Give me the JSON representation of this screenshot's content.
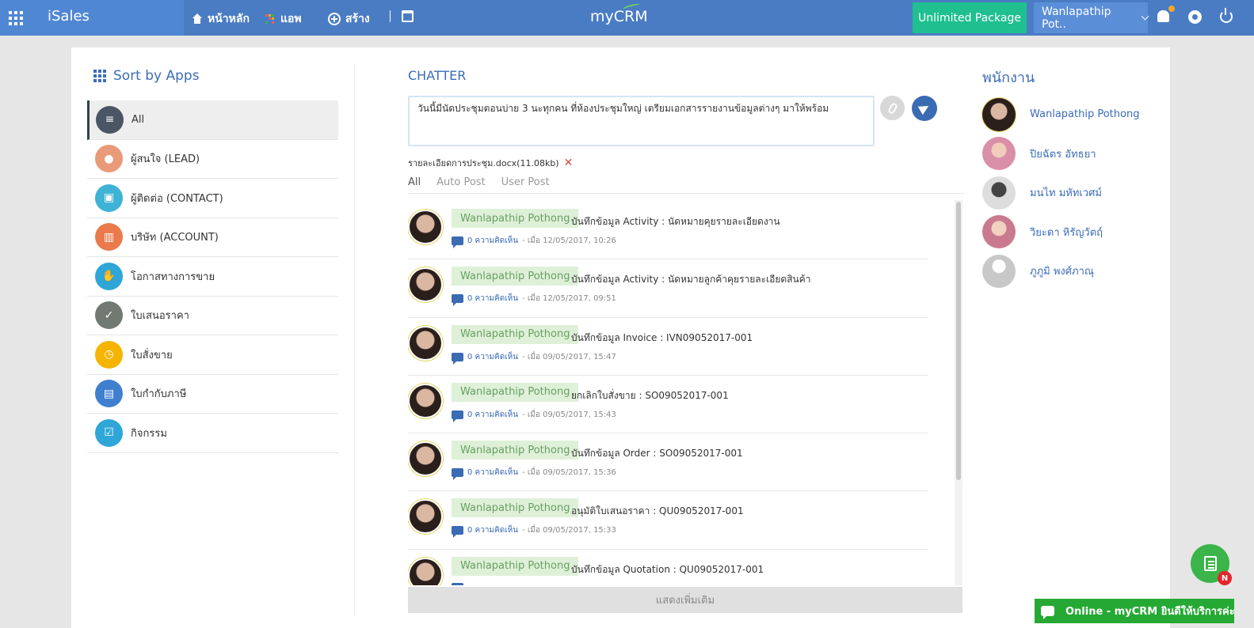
{
  "topbar": {
    "brand": "iSales",
    "nav": {
      "home": "หน้าหลัก",
      "apps": "แอพ",
      "create": "สร้าง"
    },
    "logo": "myCRM",
    "package": "Unlimited Package",
    "user": "Wanlapathip Pot..",
    "colors": {
      "bar": "#4a7cc4",
      "package": "#1fbf8f",
      "notify_dot": "#f5a623"
    }
  },
  "sort": {
    "title": "Sort by Apps",
    "items": [
      {
        "label": "All",
        "color": "#4a5565",
        "icon": "list-icon"
      },
      {
        "label": "ผู้สนใจ (LEAD)",
        "color": "#e99a78",
        "icon": "lead-icon"
      },
      {
        "label": "ผู้ติดต่อ (CONTACT)",
        "color": "#3fb3d6",
        "icon": "contact-card-icon"
      },
      {
        "label": "บริษัท (ACCOUNT)",
        "color": "#ea7a4c",
        "icon": "building-icon"
      },
      {
        "label": "โอกาสทางการขาย",
        "color": "#2ea6d8",
        "icon": "opportunity-icon"
      },
      {
        "label": "ใบเสนอราคา",
        "color": "#707a72",
        "icon": "quotation-icon"
      },
      {
        "label": "ใบสั่งขาย",
        "color": "#f5b400",
        "icon": "sales-order-icon"
      },
      {
        "label": "ใบกำกับภาษี",
        "color": "#3e7fd0",
        "icon": "invoice-icon"
      },
      {
        "label": "กิจกรรม",
        "color": "#2ea6d8",
        "icon": "activity-icon"
      }
    ]
  },
  "chatter": {
    "title": "CHATTER",
    "post_text": "วันนี้มีนัดประชุมตอนบ่าย 3 นะทุกคน ที่ห้องประชุมใหญ่ เตรียมเอกสารรายงานข้อมูลต่างๆ มาให้พร้อม",
    "attachment": "รายละเอียดการประชุม.docx(11.08kb)",
    "tabs": [
      "All",
      "Auto Post",
      "User Post"
    ],
    "feed": [
      {
        "author": "Wanlapathip Pothong",
        "text": "บันทึกข้อมูล Activity : นัดหมายคุยรายละเอียดงาน",
        "comments": "0 ความคิดเห็น",
        "time": "- เมื่อ 12/05/2017, 10:26"
      },
      {
        "author": "Wanlapathip Pothong",
        "text": "บันทึกข้อมูล Activity : นัดหมายลูกค้าคุยรายละเอียดสินค้า",
        "comments": "0 ความคิดเห็น",
        "time": "- เมื่อ 12/05/2017, 09:51"
      },
      {
        "author": "Wanlapathip Pothong",
        "text": "บันทึกข้อมูล Invoice : IVN09052017-001",
        "comments": "0 ความคิดเห็น",
        "time": "- เมื่อ 09/05/2017, 15:47"
      },
      {
        "author": "Wanlapathip Pothong",
        "text": "ยกเลิกใบสั่งขาย : SO09052017-001",
        "comments": "0 ความคิดเห็น",
        "time": "- เมื่อ 09/05/2017, 15:43"
      },
      {
        "author": "Wanlapathip Pothong",
        "text": "บันทึกข้อมูล Order : SO09052017-001",
        "comments": "0 ความคิดเห็น",
        "time": "- เมื่อ 09/05/2017, 15:36"
      },
      {
        "author": "Wanlapathip Pothong",
        "text": "อนุมัติใบเสนอราคา : QU09052017-001",
        "comments": "0 ความคิดเห็น",
        "time": "- เมื่อ 09/05/2017, 15:33"
      },
      {
        "author": "Wanlapathip Pothong",
        "text": "บันทึกข้อมูล Quotation : QU09052017-001",
        "comments": "",
        "time": ""
      }
    ],
    "more": "แสดงเพิ่มเติม"
  },
  "staff": {
    "title": "พนักงาน",
    "members": [
      "Wanlapathip Pothong",
      "ปิยฉัตร อัทธยา",
      "มนไท มหัทเวศม์",
      "วิยะดา หิรัญวัตฤ์",
      "ภูภูมิ พงศ์ภาณุ"
    ]
  },
  "floating": {
    "badge": "N",
    "online": "Online - myCRM ยินดีให้บริการค่ะ"
  }
}
